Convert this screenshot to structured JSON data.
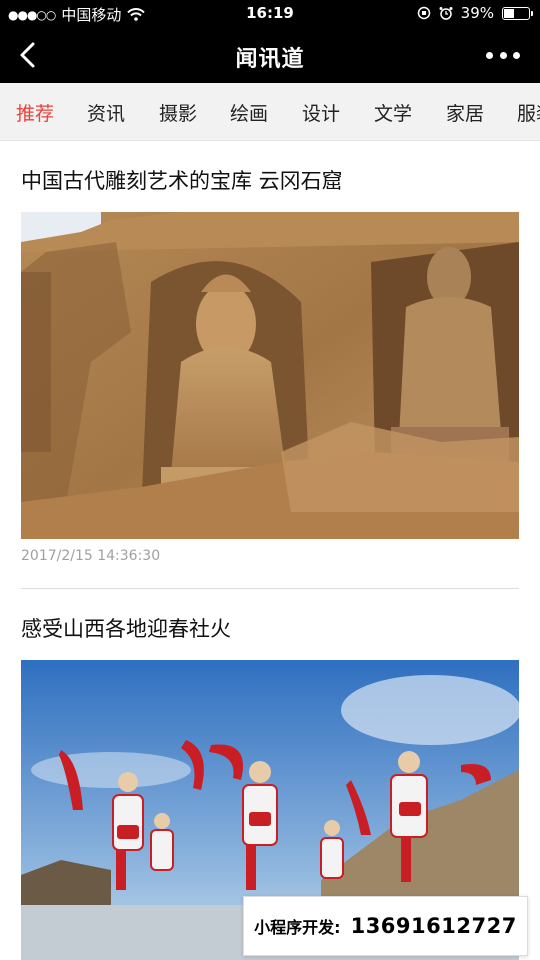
{
  "status_bar": {
    "carrier": "中国移动",
    "time": "16:19",
    "battery": "39%",
    "battery_level": 0.39
  },
  "nav": {
    "title": "闻讯道",
    "back_icon": "chevron-left-icon",
    "more_icon": "more-dots-icon"
  },
  "tabs": [
    {
      "label": "推荐",
      "active": true
    },
    {
      "label": "资讯",
      "active": false
    },
    {
      "label": "摄影",
      "active": false
    },
    {
      "label": "绘画",
      "active": false
    },
    {
      "label": "设计",
      "active": false
    },
    {
      "label": "文学",
      "active": false
    },
    {
      "label": "家居",
      "active": false
    },
    {
      "label": "服装",
      "active": false
    }
  ],
  "articles": [
    {
      "title": "中国古代雕刻艺术的宝库 云冈石窟",
      "date": "2017/2/15 14:36:30",
      "image": "yungang-grottoes-buddha-photo"
    },
    {
      "title": "感受山西各地迎春社火",
      "image": "shehuo-drum-dance-photo"
    }
  ],
  "watermark": {
    "label": "小程序开发:",
    "phone": "13691612727"
  },
  "colors": {
    "accent": "#e8453c",
    "nav_bg": "#000000",
    "tab_bg": "#f2f2f2"
  }
}
